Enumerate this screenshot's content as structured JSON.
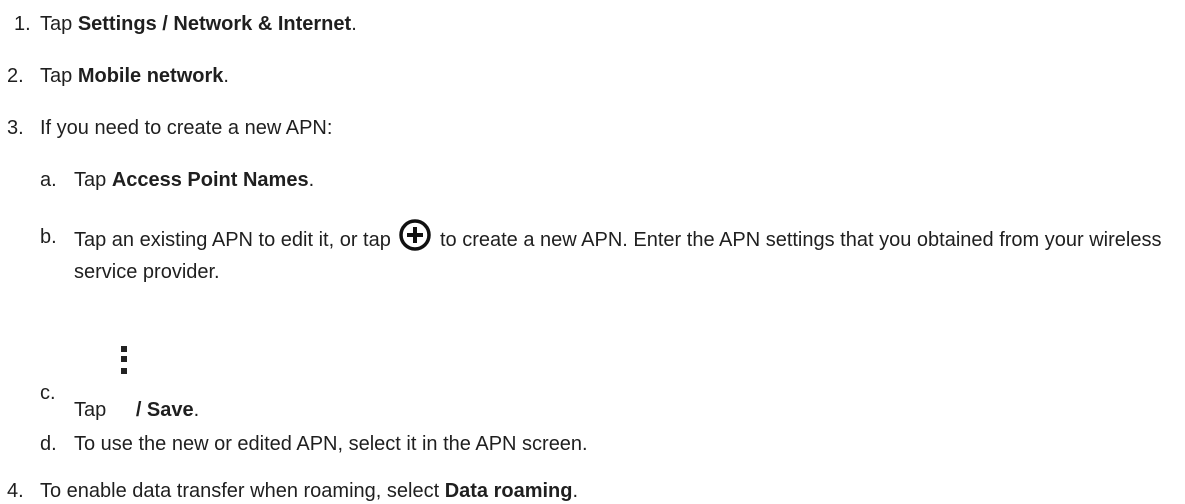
{
  "steps": [
    {
      "num": "1.",
      "pre": "Tap ",
      "bold": "Settings / Network & Internet",
      "post": "."
    },
    {
      "num": "2.",
      "pre": "Tap ",
      "bold": "Mobile network",
      "post": "."
    },
    {
      "num": "3.",
      "text": "If you need to create a new APN:"
    },
    {
      "num": "4.",
      "pre": "To enable data transfer when roaming, select ",
      "bold": "Data roaming",
      "post": "."
    }
  ],
  "substeps": [
    {
      "letter": "a.",
      "pre": "Tap ",
      "bold": "Access Point Names",
      "post": "."
    },
    {
      "letter": "b.",
      "pre": "Tap an existing APN to edit it, or tap ",
      "icon": "add-circle-icon",
      "post": " to create a new APN. Enter the APN settings that you obtained from your wireless service provider."
    },
    {
      "letter": "c.",
      "pre": "Tap ",
      "icon": "more-vertical-icon",
      "bold": "/ Save",
      "post": "."
    },
    {
      "letter": "d.",
      "text": "To use the new or edited APN, select it in the APN screen."
    }
  ]
}
